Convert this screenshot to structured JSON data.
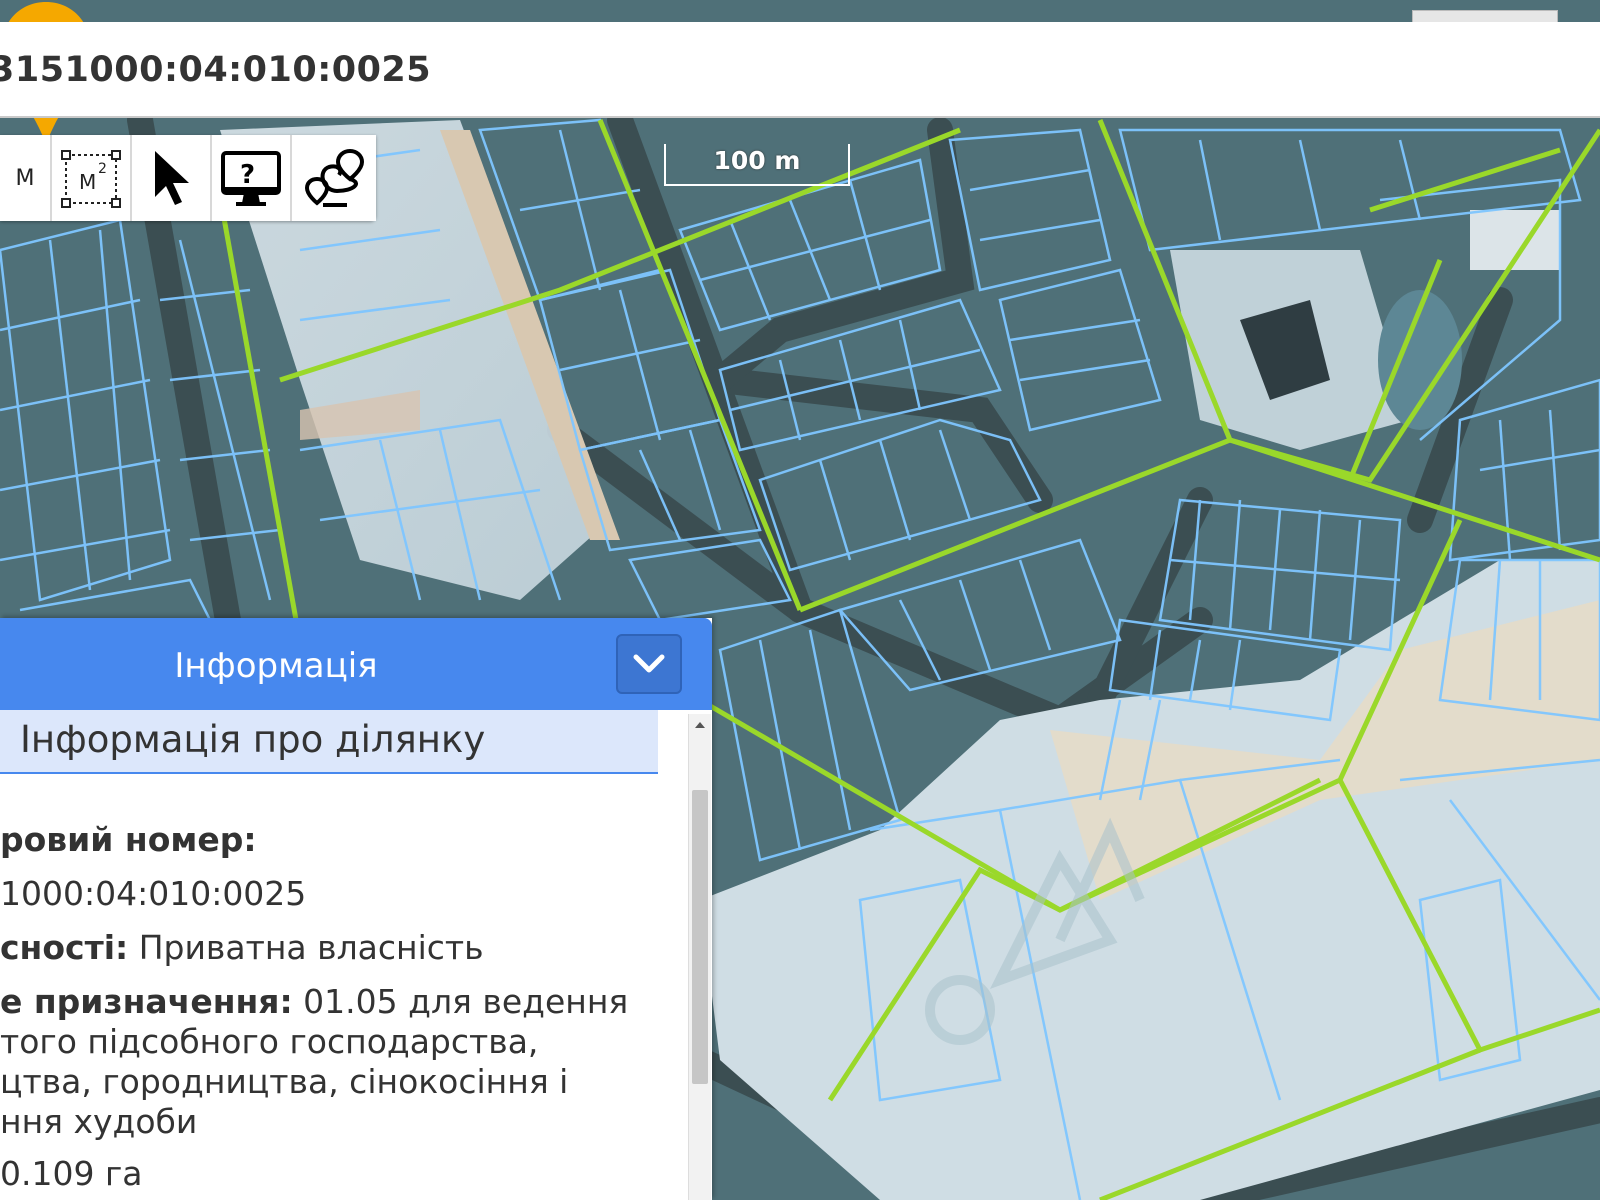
{
  "map": {
    "scale_label": "100 m"
  },
  "topbar": {
    "cadastral_number": "3151000:04:010:0025"
  },
  "toolbar": {
    "tools": [
      {
        "label": "M",
        "icon": "measure-distance-icon"
      },
      {
        "label": "M²",
        "icon": "measure-area-icon"
      },
      {
        "label": "",
        "icon": "cursor-icon"
      },
      {
        "label": "",
        "icon": "monitor-help-icon"
      },
      {
        "label": "",
        "icon": "route-icon"
      }
    ]
  },
  "info_panel": {
    "header_title": "Інформація",
    "tab_label": "Інформація про ділянку",
    "rows": {
      "cadastral_label": "ровий номер:",
      "cadastral_value": "1000:04:010:0025",
      "ownership_label": "сності:",
      "ownership_value": " Приватна власність",
      "purpose_label": "е призначення:",
      "purpose_value_1": " 01.05 для ведення",
      "purpose_value_2": "того підсобного господарства,",
      "purpose_value_3": "цтва, городництва, сінокосіння і",
      "purpose_value_4": "ння худоби",
      "area_value": " 0.109 га"
    }
  },
  "colors": {
    "panel_header": "#4788ee",
    "marker": "#f5a800",
    "parcel_line": "#7fc6ff",
    "boundary_line": "#9ad82a"
  }
}
